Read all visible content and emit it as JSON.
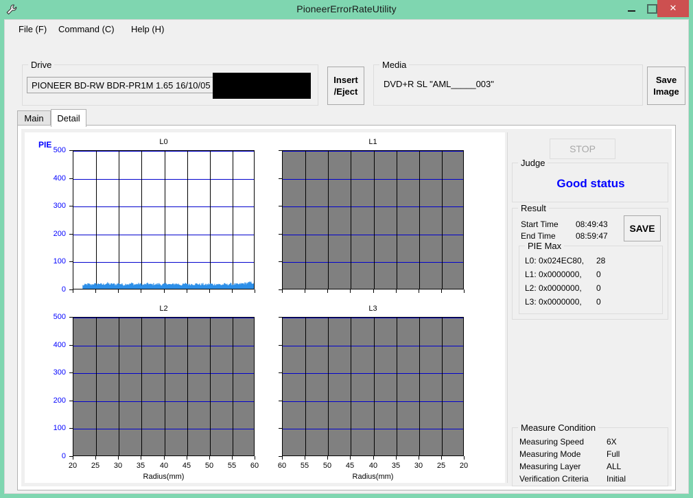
{
  "window": {
    "title": "PioneerErrorRateUtility",
    "icon": "wrench-icon",
    "titlebar_color": "#7fd6b0",
    "close_color": "#cd5050",
    "minimize_label": "–",
    "maximize_label": "□",
    "close_label": "✕"
  },
  "menubar": {
    "items": [
      {
        "label": "File (F)"
      },
      {
        "label": "Command (C)"
      },
      {
        "label": "Help (H)"
      }
    ]
  },
  "drive": {
    "group_title": "Drive",
    "selected": "PIONEER BD-RW  BDR-PR1M  1.65 16/10/05",
    "arrow": "∨",
    "redacted": true
  },
  "insert_eject": {
    "line1": "Insert",
    "line2": "/Eject"
  },
  "media": {
    "group_title": "Media",
    "value": "DVD+R SL \"AML_____003\""
  },
  "save_image": {
    "line1": "Save",
    "line2": "Image"
  },
  "tabs": [
    {
      "label": "Main",
      "active": false
    },
    {
      "label": "Detail",
      "active": true
    }
  ],
  "sidepanel": {
    "stop_label": "STOP",
    "stop_enabled": false,
    "judge": {
      "group_title": "Judge",
      "value": "Good status",
      "color": "#0000ff"
    },
    "result": {
      "group_title": "Result",
      "start_time_label": "Start Time",
      "start_time_value": "08:49:43",
      "end_time_label": "End Time",
      "end_time_value": "08:59:47",
      "save_label": "SAVE",
      "pie_max": {
        "group_title": "PIE Max",
        "rows": [
          {
            "label": "L0: 0x024EC80,",
            "value": "28"
          },
          {
            "label": "L1: 0x0000000,",
            "value": "0"
          },
          {
            "label": "L2: 0x0000000,",
            "value": "0"
          },
          {
            "label": "L3: 0x0000000,",
            "value": "0"
          }
        ]
      }
    },
    "measure_condition": {
      "group_title": "Measure Condition",
      "rows": [
        {
          "label": "Measuring Speed",
          "value": "6X"
        },
        {
          "label": "Measuring Mode",
          "value": "Full"
        },
        {
          "label": "Measuring Layer",
          "value": "ALL"
        },
        {
          "label": "Verification Criteria",
          "value": "Initial"
        }
      ]
    }
  },
  "chart_data": [
    {
      "type": "area",
      "title": "L0",
      "ylabel": "PIE",
      "xlabel": "Radius(mm)",
      "ylim": [
        0,
        500
      ],
      "yticks": [
        0,
        100,
        200,
        300,
        400,
        500
      ],
      "xlim": [
        20,
        60
      ],
      "xticks": [
        20,
        25,
        30,
        35,
        40,
        45,
        50,
        55,
        60
      ],
      "x_reversed": false,
      "has_data": true,
      "grid": true,
      "series_color": "#2d8fe8",
      "x": [
        22.0,
        22.6,
        23.2,
        23.8,
        24.4,
        25.0,
        25.6,
        26.2,
        26.8,
        27.4,
        28.0,
        28.6,
        29.2,
        29.8,
        30.4,
        31.0,
        31.6,
        32.2,
        32.8,
        33.4,
        34.0,
        34.6,
        35.2,
        35.8,
        36.4,
        37.0,
        37.6,
        38.2,
        38.8,
        39.4,
        40.0,
        40.6,
        41.2,
        41.8,
        42.4,
        43.0,
        43.6,
        44.2,
        44.8,
        45.4,
        46.0,
        46.6,
        47.2,
        47.8,
        48.4,
        49.0,
        49.6,
        50.2,
        50.8,
        51.4,
        52.0,
        52.6,
        53.2,
        53.8,
        54.4,
        55.0,
        55.6,
        56.2,
        56.8,
        57.4,
        58.0,
        58.3,
        58.6,
        58.9,
        59.2,
        59.5,
        59.8
      ],
      "values": [
        16,
        19,
        21,
        18,
        22,
        20,
        23,
        19,
        21,
        24,
        20,
        22,
        19,
        23,
        21,
        18,
        22,
        20,
        24,
        19,
        21,
        22,
        18,
        20,
        23,
        19,
        21,
        20,
        22,
        18,
        21,
        23,
        19,
        20,
        22,
        21,
        18,
        20,
        23,
        19,
        21,
        20,
        22,
        19,
        21,
        18,
        20,
        22,
        19,
        21,
        20,
        18,
        21,
        19,
        22,
        20,
        21,
        19,
        22,
        23,
        24,
        25,
        26,
        27,
        26,
        24,
        18
      ]
    },
    {
      "type": "area",
      "title": "L1",
      "ylabel": "",
      "xlabel": "Radius(mm)",
      "ylim": [
        0,
        500
      ],
      "yticks": [
        0,
        100,
        200,
        300,
        400,
        500
      ],
      "xlim": [
        60,
        20
      ],
      "xticks": [
        60,
        55,
        50,
        45,
        40,
        35,
        30,
        25,
        20
      ],
      "x_reversed": true,
      "has_data": false,
      "grid": true,
      "series_color": "#2d8fe8",
      "x": [],
      "values": []
    },
    {
      "type": "area",
      "title": "L2",
      "ylabel": "",
      "xlabel": "Radius(mm)",
      "ylim": [
        0,
        500
      ],
      "yticks": [
        0,
        100,
        200,
        300,
        400,
        500
      ],
      "xlim": [
        20,
        60
      ],
      "xticks": [
        20,
        25,
        30,
        35,
        40,
        45,
        50,
        55,
        60
      ],
      "x_reversed": false,
      "has_data": false,
      "grid": true,
      "series_color": "#2d8fe8",
      "x": [],
      "values": []
    },
    {
      "type": "area",
      "title": "L3",
      "ylabel": "",
      "xlabel": "Radius(mm)",
      "ylim": [
        0,
        500
      ],
      "yticks": [
        0,
        100,
        200,
        300,
        400,
        500
      ],
      "xlim": [
        60,
        20
      ],
      "xticks": [
        60,
        55,
        50,
        45,
        40,
        35,
        30,
        25,
        20
      ],
      "x_reversed": true,
      "has_data": false,
      "grid": true,
      "series_color": "#2d8fe8",
      "x": [],
      "values": []
    }
  ]
}
